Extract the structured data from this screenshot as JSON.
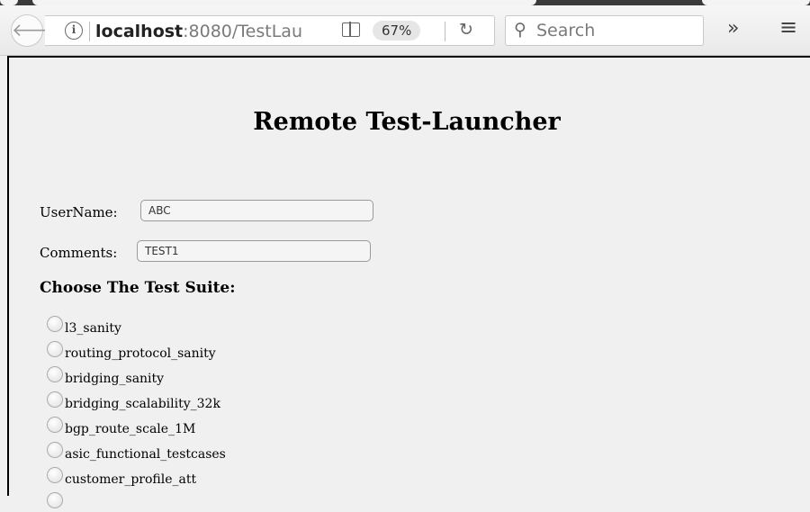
{
  "browser": {
    "url_host": "localhost",
    "url_rest": ":8080/TestLau",
    "zoom_level": "67%",
    "search_placeholder": "Search",
    "icons": [
      "back-arrow-icon",
      "info-icon",
      "reader-view-icon",
      "reload-icon",
      "search-icon",
      "overflow-chevron-icon",
      "hamburger-menu-icon"
    ]
  },
  "page": {
    "title": "Remote Test-Launcher",
    "username_label": "UserName:",
    "username_value": "ABC",
    "comments_label": "Comments:",
    "comments_value": "TEST1",
    "suite_heading": "Choose The Test Suite:",
    "suites": [
      "l3_sanity",
      "routing_protocol_sanity",
      "bridging_sanity",
      "bridging_scalability_32k",
      "bgp_route_scale_1M",
      "asic_functional_testcases",
      "customer_profile_att"
    ]
  }
}
